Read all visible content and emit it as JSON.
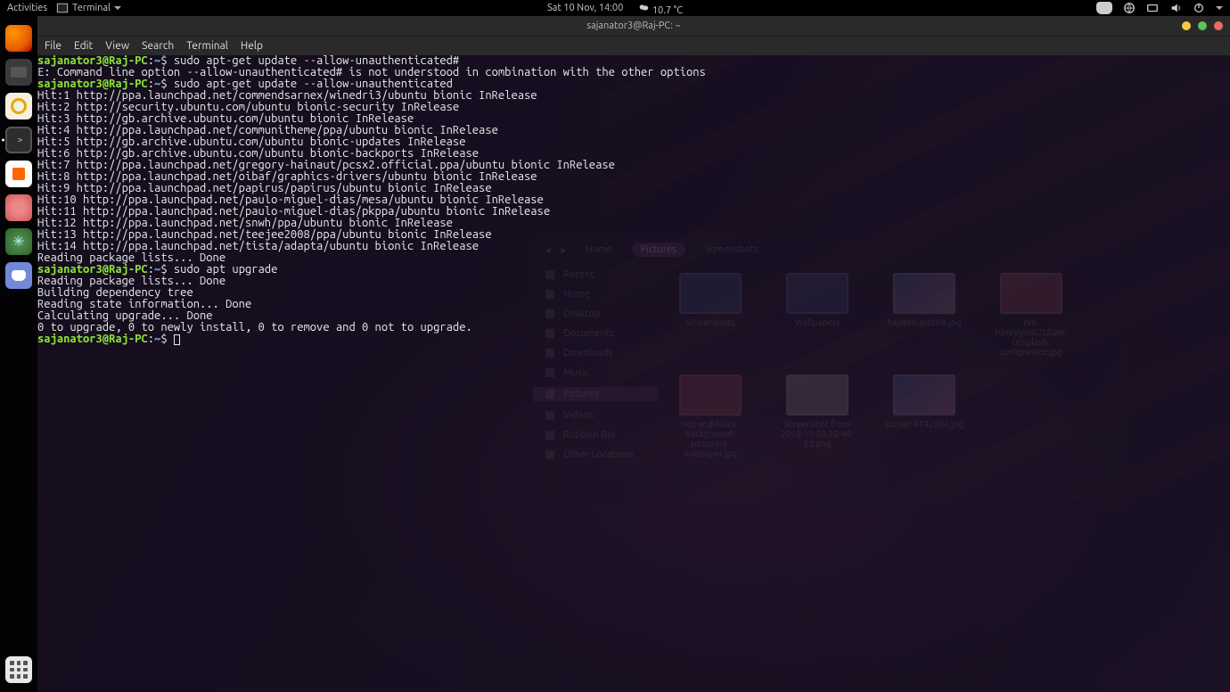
{
  "topbar": {
    "activities": "Activities",
    "app_label": "Terminal",
    "datetime": "Sat 10 Nov, 14:00",
    "weather": "10.7 °C"
  },
  "dock": {
    "items": [
      {
        "name": "firefox",
        "interact": true
      },
      {
        "name": "files",
        "interact": true
      },
      {
        "name": "rhythmbox",
        "interact": true
      },
      {
        "name": "terminal",
        "interact": true,
        "active": true
      },
      {
        "name": "software",
        "interact": true
      },
      {
        "name": "updater",
        "interact": true
      },
      {
        "name": "atom",
        "interact": true
      },
      {
        "name": "discord",
        "interact": true
      }
    ]
  },
  "window": {
    "title": "sajanator3@Raj-PC: ~",
    "menus": [
      "File",
      "Edit",
      "View",
      "Search",
      "Terminal",
      "Help"
    ]
  },
  "terminal": {
    "prompt_user": "sajanator3@Raj-PC",
    "prompt_path": "~",
    "lines": [
      {
        "t": "prompt",
        "cmd": "sudo apt-get update --allow-unauthenticated#"
      },
      {
        "t": "out",
        "text": "E: Command line option --allow-unauthenticated# is not understood in combination with the other options"
      },
      {
        "t": "prompt",
        "cmd": "sudo apt-get update --allow-unauthenticated"
      },
      {
        "t": "out",
        "text": "Hit:1 http://ppa.launchpad.net/commendsarnex/winedri3/ubuntu bionic InRelease"
      },
      {
        "t": "out",
        "text": "Hit:2 http://security.ubuntu.com/ubuntu bionic-security InRelease"
      },
      {
        "t": "out",
        "text": "Hit:3 http://gb.archive.ubuntu.com/ubuntu bionic InRelease"
      },
      {
        "t": "out",
        "text": "Hit:4 http://ppa.launchpad.net/communitheme/ppa/ubuntu bionic InRelease"
      },
      {
        "t": "out",
        "text": "Hit:5 http://gb.archive.ubuntu.com/ubuntu bionic-updates InRelease"
      },
      {
        "t": "out",
        "text": "Hit:6 http://gb.archive.ubuntu.com/ubuntu bionic-backports InRelease"
      },
      {
        "t": "out",
        "text": "Hit:7 http://ppa.launchpad.net/gregory-hainaut/pcsx2.official.ppa/ubuntu bionic InRelease"
      },
      {
        "t": "out",
        "text": "Hit:8 http://ppa.launchpad.net/oibaf/graphics-drivers/ubuntu bionic InRelease"
      },
      {
        "t": "out",
        "text": "Hit:9 http://ppa.launchpad.net/papirus/papirus/ubuntu bionic InRelease"
      },
      {
        "t": "out",
        "text": "Hit:10 http://ppa.launchpad.net/paulo-miguel-dias/mesa/ubuntu bionic InRelease"
      },
      {
        "t": "out",
        "text": "Hit:11 http://ppa.launchpad.net/paulo-miguel-dias/pkppa/ubuntu bionic InRelease"
      },
      {
        "t": "out",
        "text": "Hit:12 http://ppa.launchpad.net/snwh/ppa/ubuntu bionic InRelease"
      },
      {
        "t": "out",
        "text": "Hit:13 http://ppa.launchpad.net/teejee2008/ppa/ubuntu bionic InRelease"
      },
      {
        "t": "out",
        "text": "Hit:14 http://ppa.launchpad.net/tista/adapta/ubuntu bionic InRelease"
      },
      {
        "t": "out",
        "text": "Reading package lists... Done"
      },
      {
        "t": "prompt",
        "cmd": "sudo apt upgrade"
      },
      {
        "t": "out",
        "text": "Reading package lists... Done"
      },
      {
        "t": "out",
        "text": "Building dependency tree"
      },
      {
        "t": "out",
        "text": "Reading state information... Done"
      },
      {
        "t": "out",
        "text": "Calculating upgrade... Done"
      },
      {
        "t": "out",
        "text": "0 to upgrade, 0 to newly install, 0 to remove and 0 not to upgrade."
      },
      {
        "t": "prompt",
        "cmd": "",
        "cursor": true
      }
    ]
  },
  "filemanager": {
    "breadcrumb": [
      "Home",
      "Pictures",
      "Screenshots"
    ],
    "active_crumb": 1,
    "sidebar": [
      "Recent",
      "Home",
      "Desktop",
      "Documents",
      "Downloads",
      "Music",
      "Pictures",
      "Videos",
      "Rubbish Bin",
      "Other Locations"
    ],
    "sidebar_selected": 6,
    "files": [
      {
        "name": "Screenshots",
        "kind": "folder"
      },
      {
        "name": "Wallpapers",
        "kind": "folder"
      },
      {
        "name": "hayden-scott-0.jpg",
        "kind": "light"
      },
      {
        "name": "nm-runeyglaat2tZuW-unsplash-compressor.jpg",
        "kind": "pink"
      },
      {
        "name": "red-and-black-background-picture-5-wallpaper.jpg",
        "kind": "pink"
      },
      {
        "name": "Screenshot from 2018-10-20 22-48-53.png",
        "kind": "shot"
      },
      {
        "name": "sunset-4742004.jpg",
        "kind": "light"
      }
    ]
  }
}
